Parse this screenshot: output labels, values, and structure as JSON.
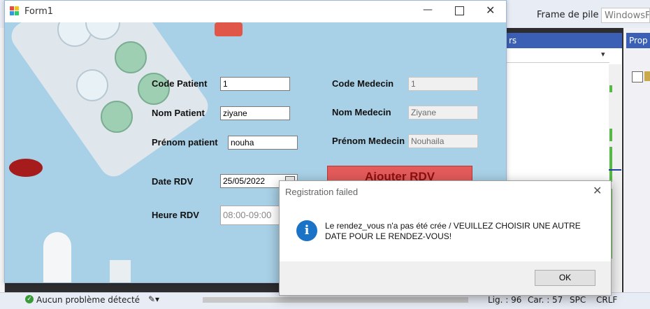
{
  "vs": {
    "toolbar_label": "Frame de pile :",
    "toolbar_value": "WindowsFo",
    "panel_title": "rs",
    "right_panel_title": "Prop",
    "status": {
      "problems": "Aucun problème détecté",
      "line": "Lig. : 96",
      "col": "Car. : 57",
      "spc": "SPC",
      "eol": "CRLF"
    }
  },
  "form": {
    "title": "Form1",
    "fields": {
      "code_patient_label": "Code Patient",
      "code_patient_value": "1",
      "nom_patient_label": "Nom Patient",
      "nom_patient_value": "ziyane",
      "prenom_patient_label": "Prénom patient",
      "prenom_patient_value": "nouha",
      "date_rdv_label": "Date RDV",
      "date_rdv_value": "25/05/2022",
      "heure_rdv_label": "Heure RDV",
      "heure_rdv_value": "08:00-09:00",
      "code_medecin_label": "Code Medecin",
      "code_medecin_value": "1",
      "nom_medecin_label": "Nom Medecin",
      "nom_medecin_value": "Ziyane",
      "prenom_medecin_label": "Prénom Medecin",
      "prenom_medecin_value": "Nouhaila"
    },
    "add_button": "Ajouter RDV"
  },
  "dialog": {
    "title": "Registration failed",
    "message": "Le rendez_vous n'a pas été crée / VEUILLEZ CHOISIR UNE AUTRE DATE POUR LE RENDEZ-VOUS!",
    "ok": "OK"
  },
  "colors": {
    "form_bg": "#a8d0e6",
    "add_button_bg": "#e35b5b",
    "vs_accent": "#3a5fb4",
    "info_icon": "#1a73c7"
  }
}
